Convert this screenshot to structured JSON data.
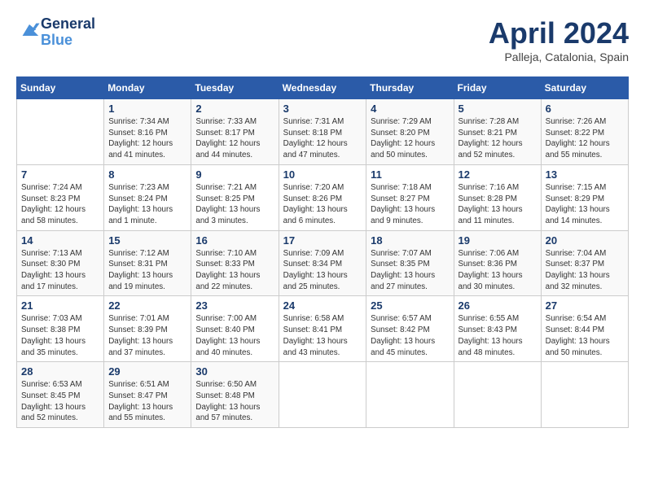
{
  "header": {
    "logo": {
      "line1": "General",
      "line2": "Blue"
    },
    "title": "April 2024",
    "location": "Palleja, Catalonia, Spain"
  },
  "days_of_week": [
    "Sunday",
    "Monday",
    "Tuesday",
    "Wednesday",
    "Thursday",
    "Friday",
    "Saturday"
  ],
  "weeks": [
    [
      {
        "day": "",
        "info": ""
      },
      {
        "day": "1",
        "info": "Sunrise: 7:34 AM\nSunset: 8:16 PM\nDaylight: 12 hours\nand 41 minutes."
      },
      {
        "day": "2",
        "info": "Sunrise: 7:33 AM\nSunset: 8:17 PM\nDaylight: 12 hours\nand 44 minutes."
      },
      {
        "day": "3",
        "info": "Sunrise: 7:31 AM\nSunset: 8:18 PM\nDaylight: 12 hours\nand 47 minutes."
      },
      {
        "day": "4",
        "info": "Sunrise: 7:29 AM\nSunset: 8:20 PM\nDaylight: 12 hours\nand 50 minutes."
      },
      {
        "day": "5",
        "info": "Sunrise: 7:28 AM\nSunset: 8:21 PM\nDaylight: 12 hours\nand 52 minutes."
      },
      {
        "day": "6",
        "info": "Sunrise: 7:26 AM\nSunset: 8:22 PM\nDaylight: 12 hours\nand 55 minutes."
      }
    ],
    [
      {
        "day": "7",
        "info": "Sunrise: 7:24 AM\nSunset: 8:23 PM\nDaylight: 12 hours\nand 58 minutes."
      },
      {
        "day": "8",
        "info": "Sunrise: 7:23 AM\nSunset: 8:24 PM\nDaylight: 13 hours\nand 1 minute."
      },
      {
        "day": "9",
        "info": "Sunrise: 7:21 AM\nSunset: 8:25 PM\nDaylight: 13 hours\nand 3 minutes."
      },
      {
        "day": "10",
        "info": "Sunrise: 7:20 AM\nSunset: 8:26 PM\nDaylight: 13 hours\nand 6 minutes."
      },
      {
        "day": "11",
        "info": "Sunrise: 7:18 AM\nSunset: 8:27 PM\nDaylight: 13 hours\nand 9 minutes."
      },
      {
        "day": "12",
        "info": "Sunrise: 7:16 AM\nSunset: 8:28 PM\nDaylight: 13 hours\nand 11 minutes."
      },
      {
        "day": "13",
        "info": "Sunrise: 7:15 AM\nSunset: 8:29 PM\nDaylight: 13 hours\nand 14 minutes."
      }
    ],
    [
      {
        "day": "14",
        "info": "Sunrise: 7:13 AM\nSunset: 8:30 PM\nDaylight: 13 hours\nand 17 minutes."
      },
      {
        "day": "15",
        "info": "Sunrise: 7:12 AM\nSunset: 8:31 PM\nDaylight: 13 hours\nand 19 minutes."
      },
      {
        "day": "16",
        "info": "Sunrise: 7:10 AM\nSunset: 8:33 PM\nDaylight: 13 hours\nand 22 minutes."
      },
      {
        "day": "17",
        "info": "Sunrise: 7:09 AM\nSunset: 8:34 PM\nDaylight: 13 hours\nand 25 minutes."
      },
      {
        "day": "18",
        "info": "Sunrise: 7:07 AM\nSunset: 8:35 PM\nDaylight: 13 hours\nand 27 minutes."
      },
      {
        "day": "19",
        "info": "Sunrise: 7:06 AM\nSunset: 8:36 PM\nDaylight: 13 hours\nand 30 minutes."
      },
      {
        "day": "20",
        "info": "Sunrise: 7:04 AM\nSunset: 8:37 PM\nDaylight: 13 hours\nand 32 minutes."
      }
    ],
    [
      {
        "day": "21",
        "info": "Sunrise: 7:03 AM\nSunset: 8:38 PM\nDaylight: 13 hours\nand 35 minutes."
      },
      {
        "day": "22",
        "info": "Sunrise: 7:01 AM\nSunset: 8:39 PM\nDaylight: 13 hours\nand 37 minutes."
      },
      {
        "day": "23",
        "info": "Sunrise: 7:00 AM\nSunset: 8:40 PM\nDaylight: 13 hours\nand 40 minutes."
      },
      {
        "day": "24",
        "info": "Sunrise: 6:58 AM\nSunset: 8:41 PM\nDaylight: 13 hours\nand 43 minutes."
      },
      {
        "day": "25",
        "info": "Sunrise: 6:57 AM\nSunset: 8:42 PM\nDaylight: 13 hours\nand 45 minutes."
      },
      {
        "day": "26",
        "info": "Sunrise: 6:55 AM\nSunset: 8:43 PM\nDaylight: 13 hours\nand 48 minutes."
      },
      {
        "day": "27",
        "info": "Sunrise: 6:54 AM\nSunset: 8:44 PM\nDaylight: 13 hours\nand 50 minutes."
      }
    ],
    [
      {
        "day": "28",
        "info": "Sunrise: 6:53 AM\nSunset: 8:45 PM\nDaylight: 13 hours\nand 52 minutes."
      },
      {
        "day": "29",
        "info": "Sunrise: 6:51 AM\nSunset: 8:47 PM\nDaylight: 13 hours\nand 55 minutes."
      },
      {
        "day": "30",
        "info": "Sunrise: 6:50 AM\nSunset: 8:48 PM\nDaylight: 13 hours\nand 57 minutes."
      },
      {
        "day": "",
        "info": ""
      },
      {
        "day": "",
        "info": ""
      },
      {
        "day": "",
        "info": ""
      },
      {
        "day": "",
        "info": ""
      }
    ]
  ]
}
